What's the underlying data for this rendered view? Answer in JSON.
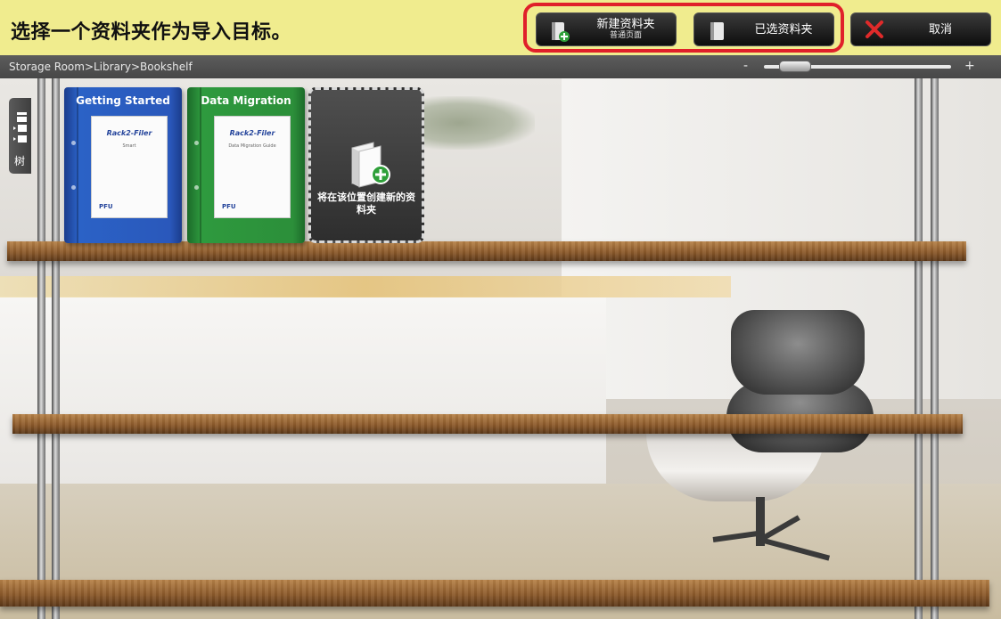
{
  "topbar": {
    "instruction": "选择一个资料夹作为导入目标。",
    "new_folder_label": "新建资料夹",
    "new_folder_sub": "普通页面",
    "selected_folder_label": "已选资料夹",
    "cancel_label": "取消"
  },
  "pathbar": {
    "breadcrumb": "Storage Room>Library>Bookshelf",
    "zoom_minus": "-",
    "zoom_plus": "+",
    "zoom_level": 0.1
  },
  "tree_tab": {
    "label": "树"
  },
  "shelf": {
    "binders": [
      {
        "title": "Getting Started",
        "color": "blue",
        "doc_logo": "Rack2-Filer",
        "doc_sub": "Smart",
        "doc_maker": "PFU"
      },
      {
        "title": "Data Migration",
        "color": "green",
        "doc_logo": "Rack2-Filer",
        "doc_sub": "Data Migration Guide",
        "doc_maker": "PFU"
      }
    ],
    "new_slot_label": "将在该位置创建新的资料夹"
  },
  "colors": {
    "topbar_bg": "#f0ec8e",
    "highlight": "#e0202a",
    "button_bg": "#1f1f1f",
    "cancel_icon": "#e02a2a",
    "binder_blue": "#2b62c6",
    "binder_green": "#2e9a3e"
  },
  "icons": {
    "new_folder": "folder-add-icon",
    "selected_folder": "folder-icon",
    "cancel": "close-icon",
    "tree": "tree-folder-icon",
    "new_slot": "binder-add-icon"
  }
}
